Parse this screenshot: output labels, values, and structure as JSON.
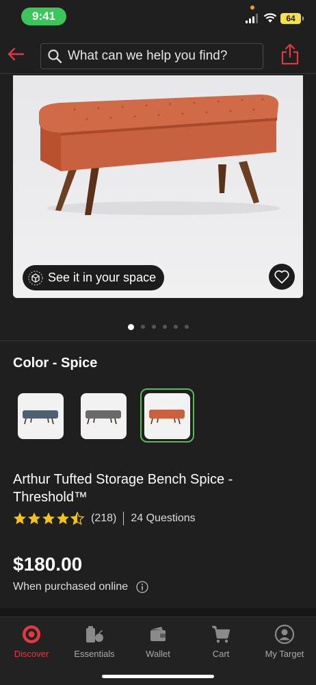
{
  "status_bar": {
    "time": "9:41",
    "battery": "64"
  },
  "header": {
    "back_icon": "back-arrow-icon",
    "search_placeholder": "What can we help you find?",
    "share_icon": "share-icon"
  },
  "gallery": {
    "see_in_space_label": "See it in your space",
    "favorite_icon": "heart-icon",
    "image_count": 6,
    "active_index": 0
  },
  "color": {
    "title": "Color - Spice",
    "swatches": [
      {
        "name": "Blue",
        "color": "#4e6173"
      },
      {
        "name": "Gray",
        "color": "#6a6a6a"
      },
      {
        "name": "Spice",
        "color": "#c7613f",
        "selected": true
      }
    ]
  },
  "product": {
    "title": "Arthur Tufted Storage Bench Spice - Threshold™",
    "rating": 4.5,
    "rating_count": "(218)",
    "questions": "24 Questions",
    "price": "$180.00",
    "price_note": "When purchased online"
  },
  "tabs": [
    {
      "label": "Discover",
      "icon": "target-logo-icon",
      "active": true
    },
    {
      "label": "Essentials",
      "icon": "essentials-icon",
      "active": false
    },
    {
      "label": "Wallet",
      "icon": "wallet-icon",
      "active": false
    },
    {
      "label": "Cart",
      "icon": "cart-icon",
      "active": false
    },
    {
      "label": "My Target",
      "icon": "profile-icon",
      "active": false
    }
  ],
  "colors": {
    "accent": "#e03a3e",
    "selected_ring": "#5cb85c",
    "star": "#f3c31a"
  }
}
